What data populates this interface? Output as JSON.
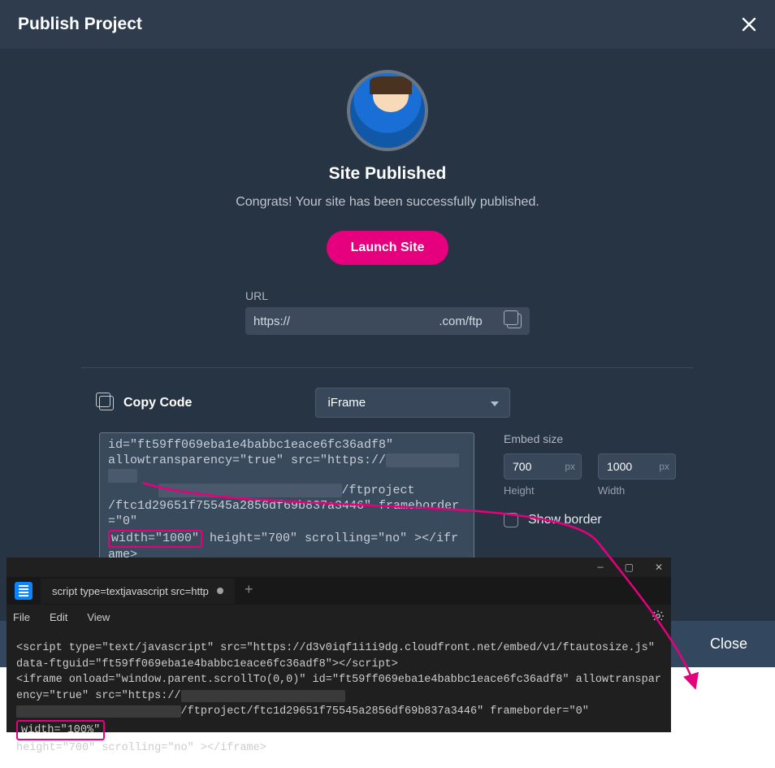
{
  "modal": {
    "title": "Publish Project",
    "site_published": "Site Published",
    "congrats": "Congrats! Your site has been successfully published.",
    "launch_btn": "Launch Site",
    "url_label": "URL",
    "url_value": "https://                                            .com/ftp",
    "close_btn": "Close"
  },
  "code_section": {
    "copy_code_label": "Copy Code",
    "select_value": "iFrame",
    "code_line1": "id=\"ft59ff069eba1e4babbc1eace6fc36adf8\"",
    "code_line2": "allowtransparency=\"true\" src=\"https://",
    "code_line3": "/ftproject",
    "code_line4": "/ftc1d29651f75545a2856df69b837a3446\" frameborder=\"0\"",
    "code_highlight": "width=\"1000\"",
    "code_line5_rest": " height=\"700\" scrolling=\"no\" ></iframe>",
    "embed_size_label": "Embed size",
    "height_value": "700",
    "width_value": "1000",
    "height_label": "Height",
    "width_label": "Width",
    "px": "px",
    "show_border": "Show border"
  },
  "editor": {
    "tab_title": "script type=textjavascript src=http",
    "menu": {
      "file": "File",
      "edit": "Edit",
      "view": "View"
    },
    "line1": "<script type=\"text/javascript\" src=\"https://d3v0iqf1i1i9dg.cloudfront.net/embed/v1/ftautosize.js\" data-ftguid=\"ft59ff069eba1e4babbc1eace6fc36adf8\"></script>",
    "line2a": "<iframe onload=\"window.parent.scrollTo(0,0)\" id=\"ft59ff069eba1e4babbc1eace6fc36adf8\" allowtransparency=\"true\" src=\"https://",
    "line2b": "/ftproject/ftc1d29651f75545a2856df69b837a3446\" frameborder=\"0\"",
    "highlight": "width=\"100%\"",
    "line3": "height=\"700\" scrolling=\"no\" ></iframe>"
  },
  "window": {
    "min": "—",
    "max": "▢",
    "close": "✕"
  }
}
